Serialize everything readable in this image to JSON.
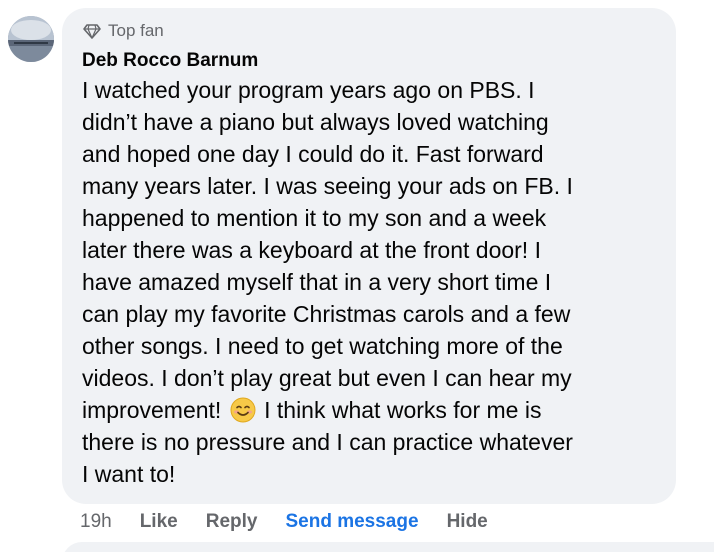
{
  "comment": {
    "badge_label": "Top fan",
    "badge_icon": "diamond-icon",
    "author": "Deb Rocco Barnum",
    "lines": [
      "I watched your program years ago on PBS. I",
      "didn’t have a piano but always loved watching",
      "and hoped one day I could do it. Fast forward",
      "many years later. I was seeing your ads on FB. I",
      "happened to mention it to my son and a week",
      "later there was a keyboard at the front door! I",
      "have amazed myself that in a very short time I",
      "can play my favorite Christmas carols and a few",
      "other songs. I need to get watching more of the",
      "videos. I don’t play great but even I can hear my"
    ],
    "emoji_line_before": "improvement!",
    "emoji_name": "smiling-face-emoji",
    "emoji_line_after": "I think what works for me is",
    "lines_after": [
      "there is no pressure and I can practice whatever",
      "I want to!"
    ]
  },
  "actions": {
    "timestamp": "19h",
    "like": "Like",
    "reply": "Reply",
    "send_message": "Send message",
    "hide": "Hide"
  },
  "colors": {
    "bubble": "#f0f2f5",
    "text": "#050505",
    "secondary": "#65676b",
    "link": "#1b74e4"
  }
}
